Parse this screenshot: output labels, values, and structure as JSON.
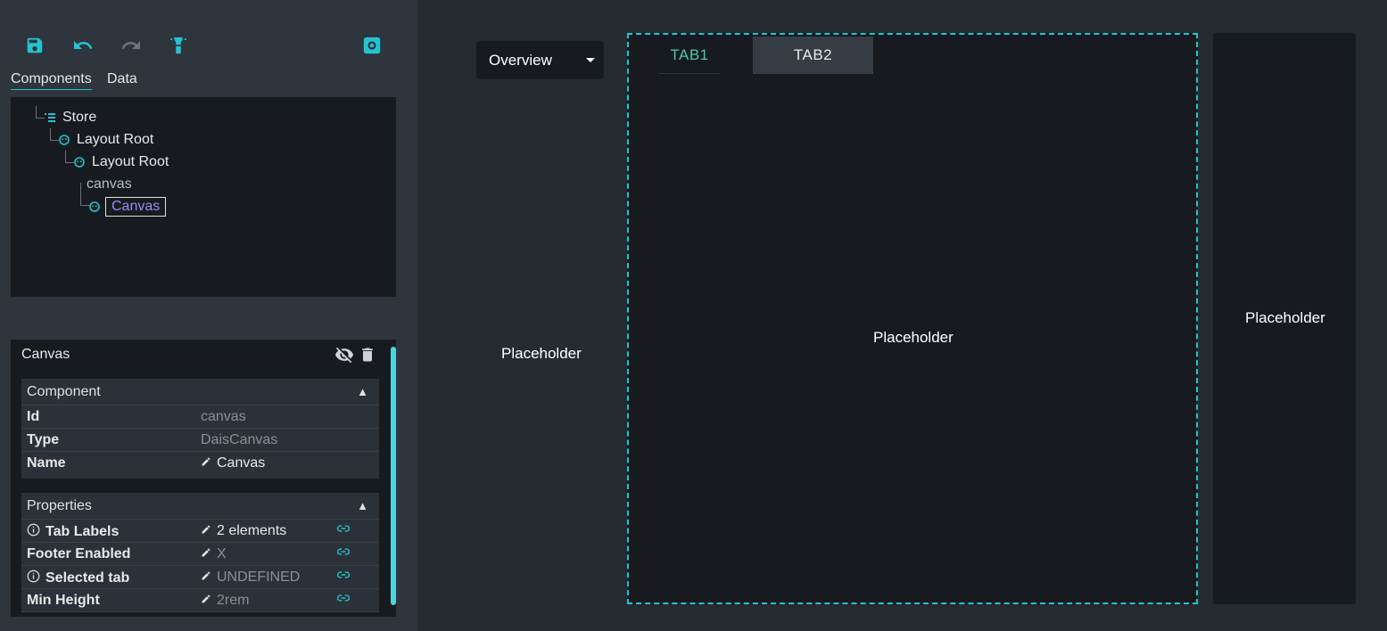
{
  "toolbar": {
    "icons": [
      "save-icon",
      "undo-icon",
      "redo-icon",
      "lightbulb-icon",
      "settings-icon"
    ]
  },
  "left_tabs": [
    {
      "label": "Components",
      "active": true
    },
    {
      "label": "Data",
      "active": false
    }
  ],
  "tree": {
    "nodes": [
      {
        "label": "Store",
        "icon": "store-list-icon"
      },
      {
        "label": "Layout Root",
        "icon": "component-icon"
      },
      {
        "label": "Layout Root",
        "icon": "component-icon"
      },
      {
        "label": "canvas",
        "icon": ""
      },
      {
        "label": "Canvas",
        "icon": "component-icon",
        "selected": true
      }
    ]
  },
  "props_panel": {
    "title": "Canvas",
    "header_icons": [
      "visibility-off-icon",
      "trash-icon"
    ],
    "component_section": {
      "title": "Component",
      "rows": [
        {
          "key": "Id",
          "value": "canvas"
        },
        {
          "key": "Type",
          "value": "DaisCanvas"
        },
        {
          "key": "Name",
          "value": "Canvas"
        }
      ]
    },
    "properties_section": {
      "title": "Properties",
      "rows": [
        {
          "key": "Tab Labels",
          "value": "2 elements"
        },
        {
          "key": "Footer Enabled",
          "value": "X"
        },
        {
          "key": "Selected tab",
          "value": "UNDEFINED"
        },
        {
          "key": "Min Height",
          "value": "2rem"
        }
      ]
    }
  },
  "main": {
    "dropdown": {
      "selected": "Overview"
    },
    "left_placeholder": "Placeholder",
    "canvas_tabs": [
      {
        "label": "TAB1",
        "active": true
      },
      {
        "label": "TAB2",
        "active": false
      }
    ],
    "canvas_placeholder": "Placeholder",
    "right_placeholder": "Placeholder"
  },
  "colors": {
    "accent": "#22c4d4",
    "selected_text": "#9a8bf5",
    "tab1_text": "#4cc9a0"
  }
}
